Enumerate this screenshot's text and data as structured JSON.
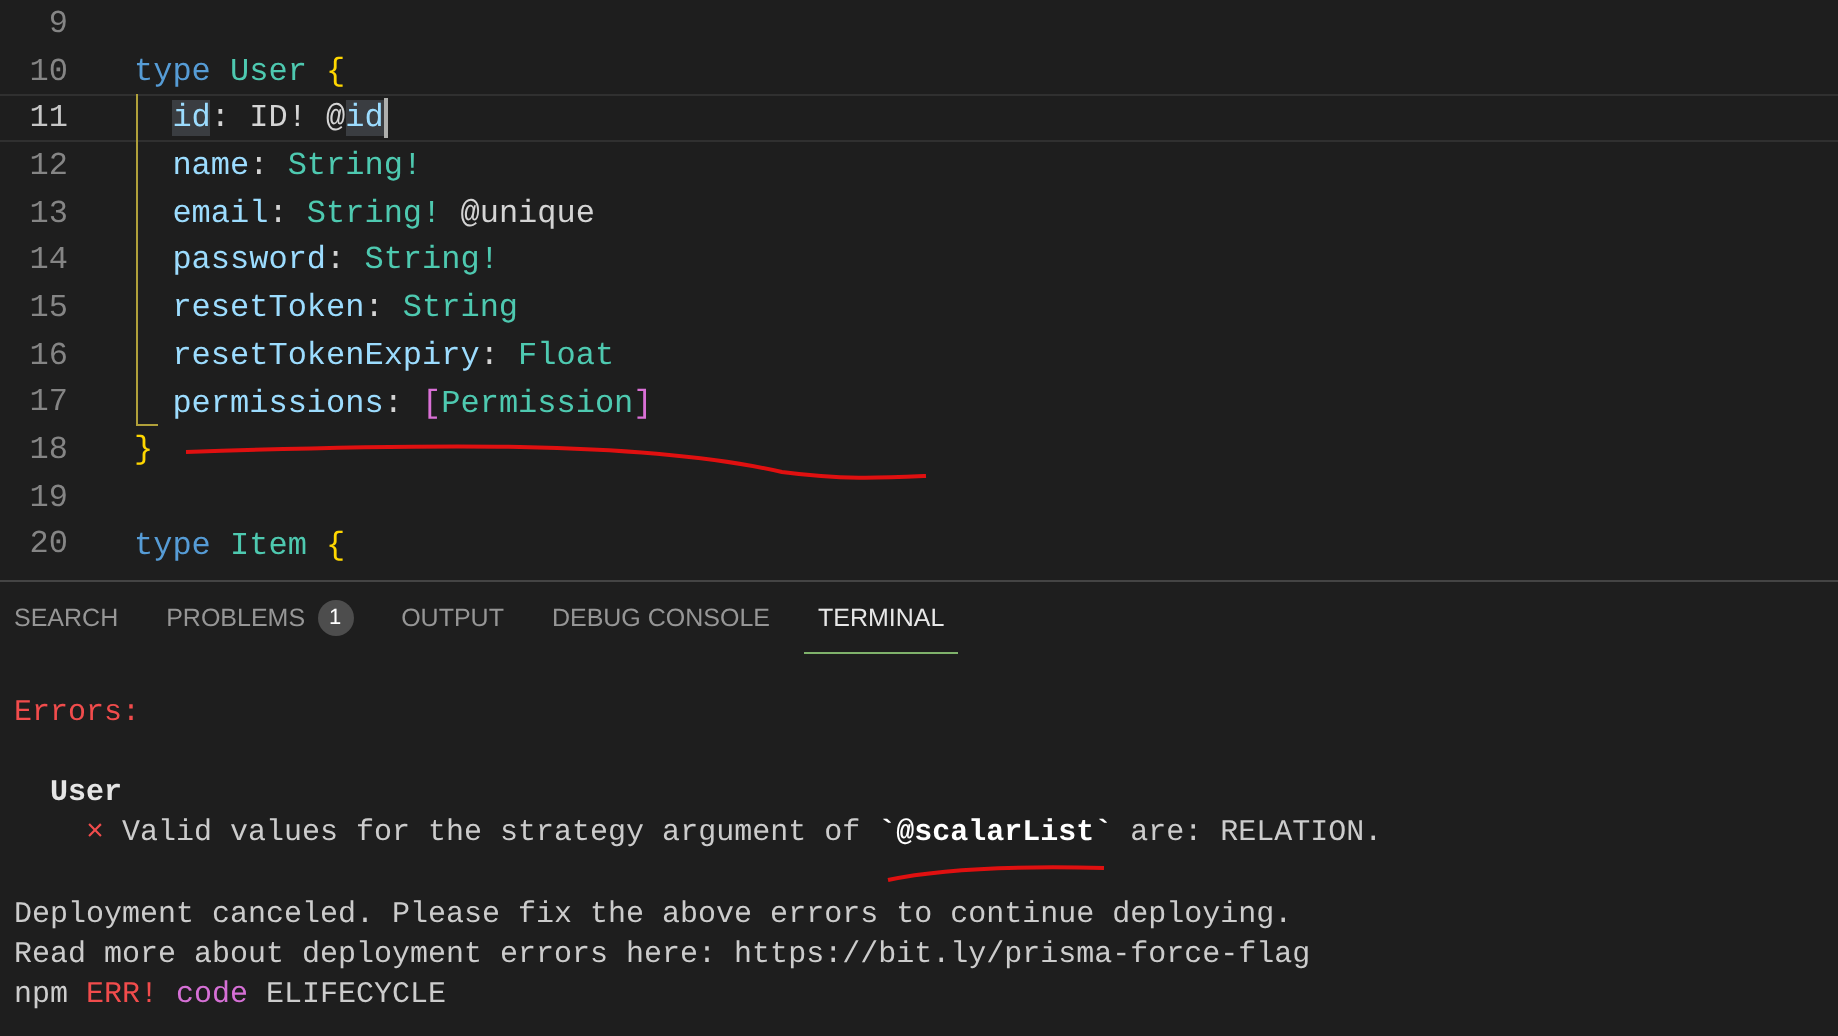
{
  "editor": {
    "lines": [
      {
        "number": "9",
        "selected": false
      },
      {
        "number": "10",
        "selected": false,
        "tokens": [
          {
            "text": "type ",
            "kind": "keyword"
          },
          {
            "text": "User ",
            "kind": "type"
          },
          {
            "text": "{",
            "kind": "brace"
          }
        ],
        "children": [
          {
            "number": "11",
            "selected": true,
            "tokens": [
              {
                "text": "id",
                "kind": "prop",
                "highlight": true
              },
              {
                "text": ": ID! @",
                "kind": "punct"
              },
              {
                "text": "id",
                "kind": "prop",
                "highlight": true
              }
            ]
          },
          {
            "number": "12",
            "selected": false,
            "tokens": [
              {
                "text": "name",
                "kind": "prop"
              },
              {
                "text": ": ",
                "kind": "punct"
              },
              {
                "text": "String!",
                "kind": "type"
              }
            ]
          },
          {
            "number": "13",
            "selected": false,
            "tokens": [
              {
                "text": "email",
                "kind": "prop"
              },
              {
                "text": ": ",
                "kind": "punct"
              },
              {
                "text": "String! ",
                "kind": "type"
              },
              {
                "text": "@unique",
                "kind": "punct"
              }
            ]
          },
          {
            "number": "14",
            "selected": false,
            "tokens": [
              {
                "text": "password",
                "kind": "prop"
              },
              {
                "text": ": ",
                "kind": "punct"
              },
              {
                "text": "String!",
                "kind": "type"
              }
            ]
          },
          {
            "number": "15",
            "selected": false,
            "tokens": [
              {
                "text": "resetToken",
                "kind": "prop"
              },
              {
                "text": ": ",
                "kind": "punct"
              },
              {
                "text": "String",
                "kind": "type"
              }
            ]
          },
          {
            "number": "16",
            "selected": false,
            "tokens": [
              {
                "text": "resetTokenExpiry",
                "kind": "prop"
              },
              {
                "text": ": ",
                "kind": "punct"
              },
              {
                "text": "Float",
                "kind": "type"
              }
            ]
          },
          {
            "number": "17",
            "selected": false,
            "tokens": [
              {
                "text": "permissions",
                "kind": "prop"
              },
              {
                "text": ": ",
                "kind": "punct"
              },
              {
                "text": "[",
                "kind": "bracket"
              },
              {
                "text": "Permission",
                "kind": "type"
              },
              {
                "text": "]",
                "kind": "bracket"
              }
            ]
          }
        ]
      },
      {
        "number": "18",
        "selected": false,
        "tokens": [
          {
            "text": "}",
            "kind": "brace"
          }
        ]
      },
      {
        "number": "19",
        "selected": false
      },
      {
        "number": "20",
        "selected": false,
        "tokens": [
          {
            "text": "type ",
            "kind": "keyword"
          },
          {
            "text": "Item ",
            "kind": "type"
          },
          {
            "text": "{",
            "kind": "brace"
          }
        ]
      }
    ]
  },
  "panel": {
    "tabs": [
      {
        "label": "SEARCH",
        "selected": false
      },
      {
        "label": "PROBLEMS",
        "selected": false,
        "badge": "1"
      },
      {
        "label": "OUTPUT",
        "selected": false
      },
      {
        "label": "DEBUG CONSOLE",
        "selected": false
      },
      {
        "label": "TERMINAL",
        "selected": true
      }
    ],
    "terminal": {
      "sections": [
        {
          "lines": [
            {
              "segments": [
                {
                  "text": "Errors:",
                  "kind": "error"
                }
              ],
              "children": [
                {
                  "segments": [
                    {
                      "text": "User",
                      "kind": "bold"
                    }
                  ],
                  "children": [
                    {
                      "segments": [
                        {
                          "text": "×",
                          "kind": "cross"
                        },
                        {
                          "text": " Valid values for the strategy argument of ",
                          "kind": "plain"
                        },
                        {
                          "text": "`@scalarList`",
                          "kind": "code"
                        },
                        {
                          "text": " are: RELATION.",
                          "kind": "plain"
                        }
                      ]
                    }
                  ]
                }
              ]
            }
          ]
        },
        {
          "lines": [
            {
              "segments": [
                {
                  "text": "Deployment canceled. Please fix the above errors to continue deploying.",
                  "kind": "plain"
                }
              ]
            },
            {
              "segments": [
                {
                  "text": "Read more about deployment errors here: https://bit.ly/prisma-force-flag",
                  "kind": "plain"
                }
              ]
            },
            {
              "segments": [
                {
                  "text": "npm ",
                  "kind": "plain"
                },
                {
                  "text": "ERR! ",
                  "kind": "error"
                },
                {
                  "text": "code",
                  "kind": "magenta"
                },
                {
                  "text": " ELIFECYCLE",
                  "kind": "plain"
                }
              ]
            }
          ]
        }
      ]
    }
  }
}
